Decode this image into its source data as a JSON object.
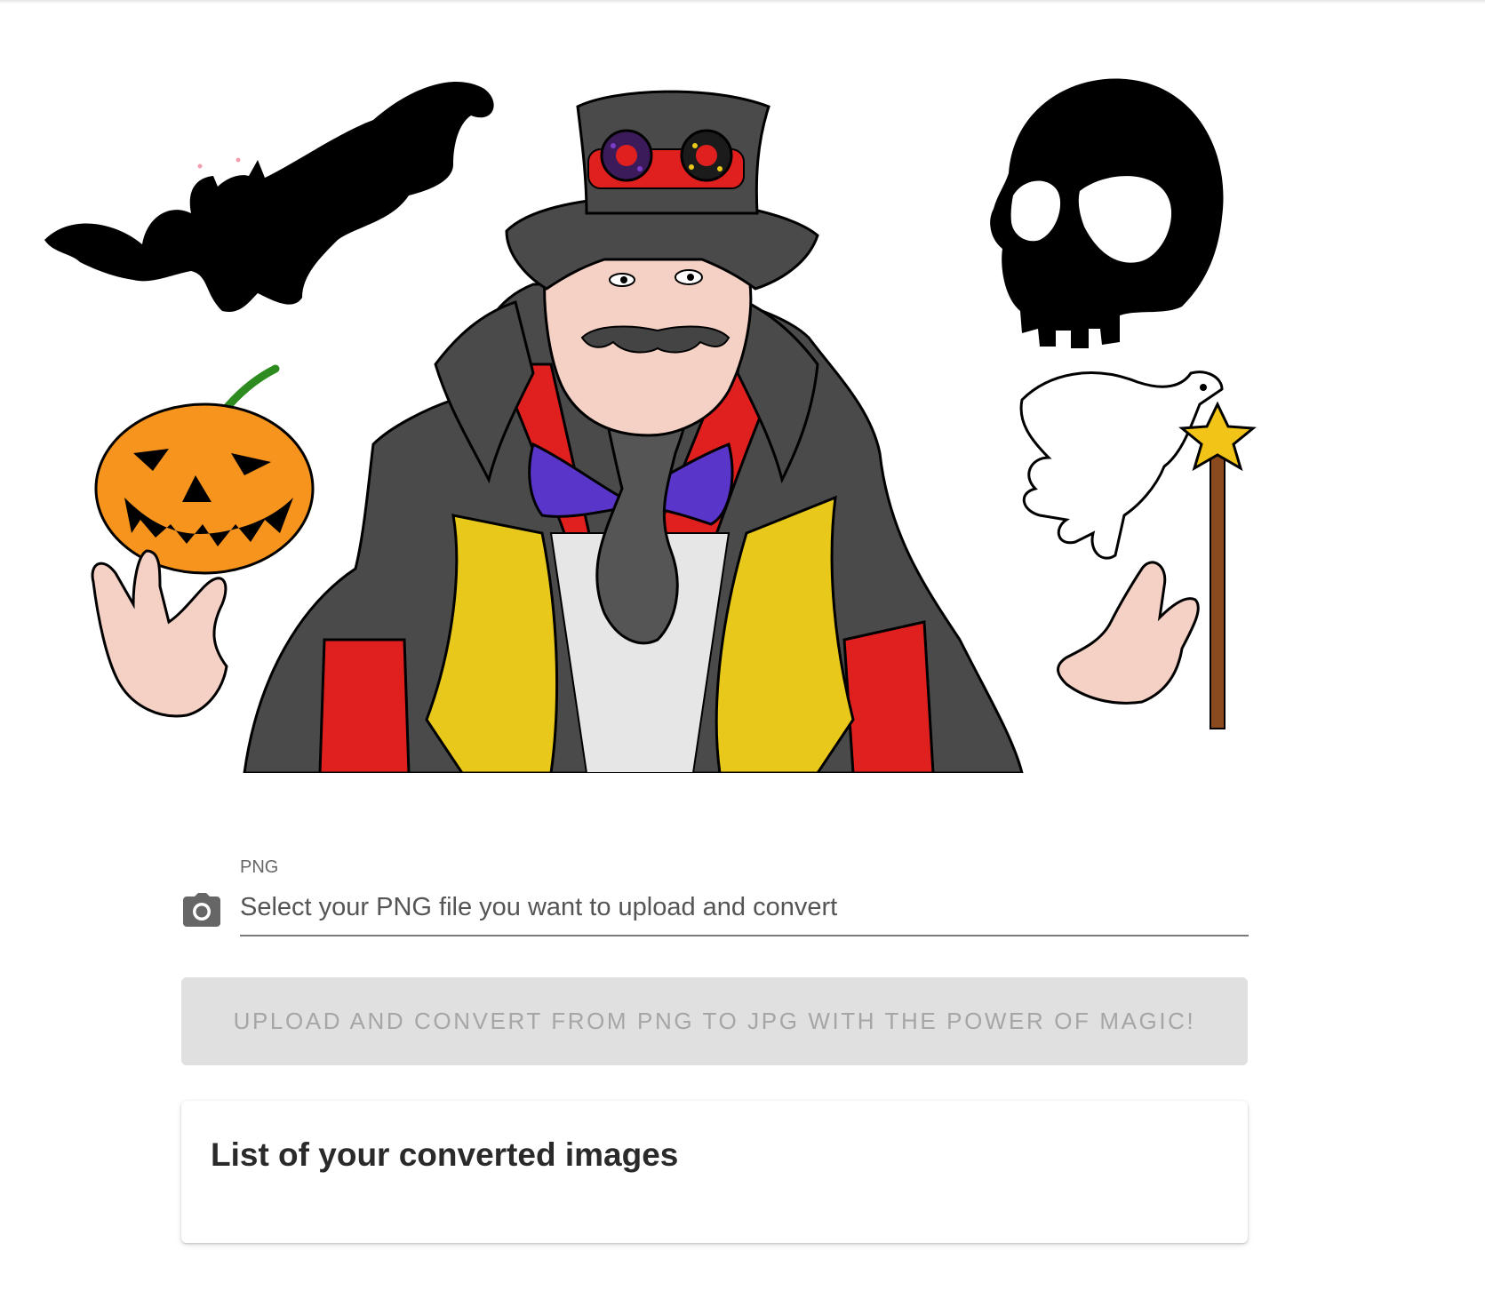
{
  "upload_form": {
    "file_label": "PNG",
    "file_placeholder": "Select your PNG file you want to upload and convert",
    "upload_button_label": "UPLOAD AND CONVERT FROM PNG TO JPG WITH THE POWER OF MAGIC!"
  },
  "converted_list": {
    "title": "List of your converted images"
  },
  "icons": {
    "file_field_icon": "camera-icon"
  },
  "colors": {
    "button_disabled_bg": "#e0e0e0",
    "button_disabled_text": "#a6a6a6",
    "input_underline": "#7a7a7a"
  }
}
